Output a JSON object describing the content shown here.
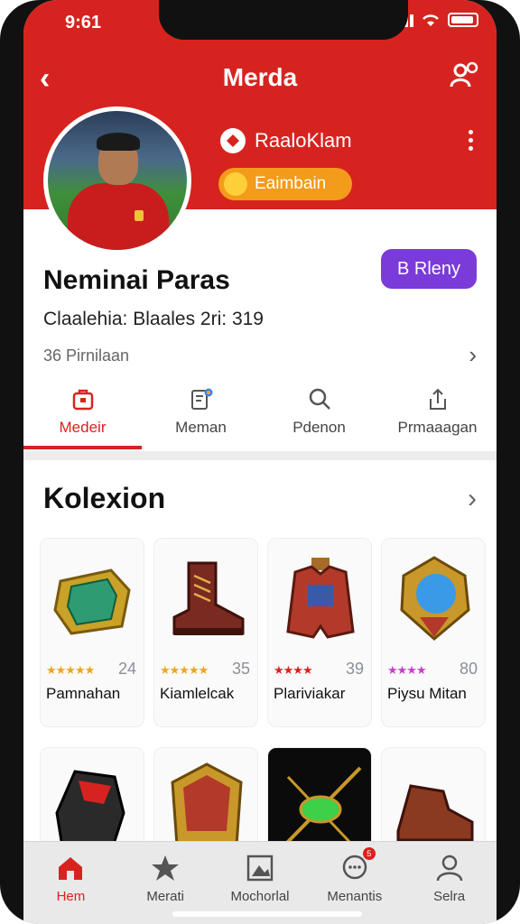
{
  "status_bar": {
    "time": "9:61"
  },
  "header": {
    "title": "Merda",
    "club": "RaaloKlam",
    "level_badge": "Eaimbain"
  },
  "profile": {
    "name": "Neminai Paras",
    "follow_button": "B Rleny",
    "stats": "Claalehia: Blaales 2ri: 319",
    "sub_link": "36 Pirnilaan"
  },
  "tabs": [
    {
      "label": "Medeir",
      "icon": "bag-icon",
      "active": true
    },
    {
      "label": "Meman",
      "icon": "note-icon",
      "active": false
    },
    {
      "label": "Pdenon",
      "icon": "search-icon",
      "active": false
    },
    {
      "label": "Prmaaagan",
      "icon": "share-icon",
      "active": false
    }
  ],
  "collection": {
    "title": "Kolexion",
    "items": [
      {
        "name": "Pamnahan",
        "score": "24",
        "stars": "★★★★★",
        "star_color": "#e9a81f",
        "icon": "armor-bracer-icon"
      },
      {
        "name": "Kiamlelcak",
        "score": "35",
        "stars": "★★★★★",
        "star_color": "#e9a81f",
        "icon": "boots-icon"
      },
      {
        "name": "Plariviakar",
        "score": "39",
        "stars": "★★★★",
        "star_color": "#d7231f",
        "icon": "vest-icon"
      },
      {
        "name": "Piysu Mitan",
        "score": "80",
        "stars": "★★★★",
        "star_color": "#c640c6",
        "icon": "amulet-icon"
      }
    ],
    "row2_icons": [
      "gauntlet-icon",
      "shield-icon",
      "gem-sword-icon",
      "shoe-icon"
    ]
  },
  "bottom_nav": [
    {
      "label": "Hem",
      "icon": "home-icon",
      "active": true
    },
    {
      "label": "Merati",
      "icon": "star-icon",
      "active": false
    },
    {
      "label": "Mochorlal",
      "icon": "picture-icon",
      "active": false
    },
    {
      "label": "Menantis",
      "icon": "chat-icon",
      "active": false,
      "badge": "5"
    },
    {
      "label": "Selra",
      "icon": "person-icon",
      "active": false
    }
  ],
  "colors": {
    "brand_red": "#d7231f",
    "purple": "#7b3bd9",
    "orange": "#f39b1a"
  }
}
